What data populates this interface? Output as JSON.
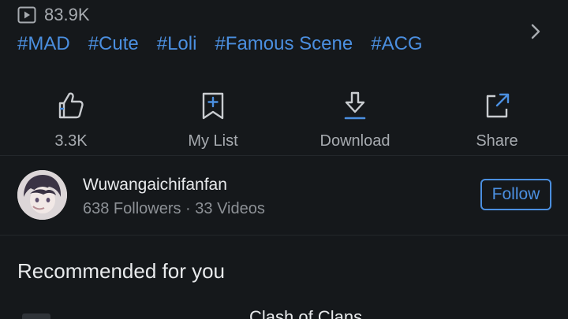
{
  "video": {
    "view_count": "83.9K",
    "tags": [
      "#MAD",
      "#Cute",
      "#Loli",
      "#Famous Scene",
      "#ACG"
    ]
  },
  "actions": {
    "like_label": "3.3K",
    "mylist_label": "My List",
    "download_label": "Download",
    "share_label": "Share"
  },
  "uploader": {
    "name": "Wuwangaichifanfan",
    "meta": "638 Followers · 33 Videos",
    "follow_label": "Follow"
  },
  "recommended": {
    "title": "Recommended for you",
    "first_item_title": "Clash of Clans"
  },
  "colors": {
    "background": "#15181b",
    "accent": "#4b8fe0",
    "muted_text": "#a7abb0"
  }
}
